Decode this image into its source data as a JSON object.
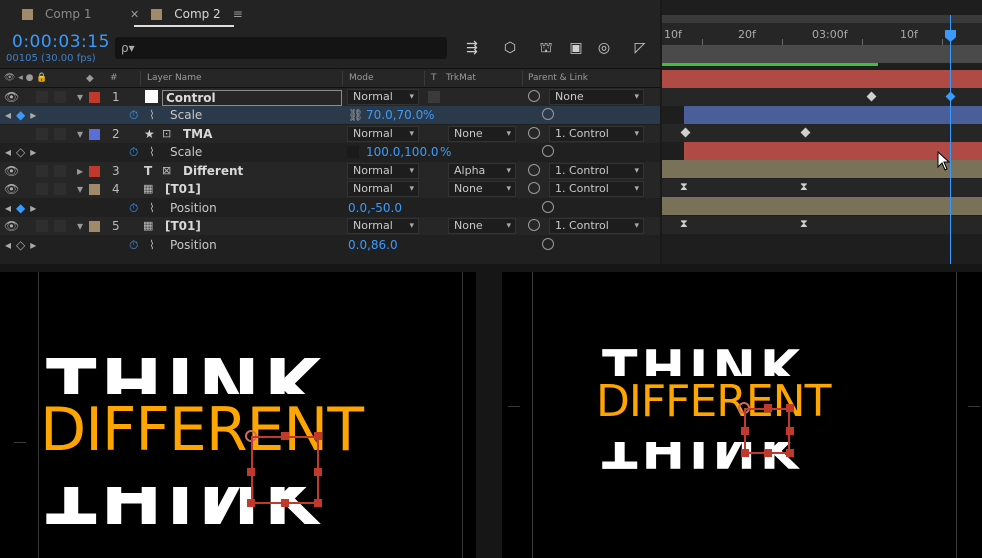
{
  "tabs": [
    {
      "label": "Comp 1",
      "color": "#a08a6a"
    },
    {
      "label": "Comp 2",
      "color": "#a08a6a",
      "active": true
    }
  ],
  "timecode": "0:00:03:15",
  "fps_info": "00105 (30.00 fps)",
  "search": {
    "placeholder": "ρ▾"
  },
  "columns": {
    "layer_name": "Layer Name",
    "mode": "Mode",
    "t": "T",
    "trkmat": "TrkMat",
    "parent": "Parent & Link",
    "hash": "#"
  },
  "layers": [
    {
      "num": "1",
      "name": "Control",
      "color": "#c0392b",
      "type_icon": "solid",
      "mode": "Normal",
      "trkmat": "",
      "parent": "None",
      "prop": {
        "name": "Scale",
        "value": "70.0,70.0",
        "unit": "%",
        "linked": true
      }
    },
    {
      "num": "2",
      "name": "TMA",
      "color": "#5a6fd6",
      "type_icon": "star",
      "mode": "Normal",
      "trkmat": "None",
      "parent": "1. Control",
      "prop": {
        "name": "Scale",
        "value": "100.0,100.0",
        "unit": "%"
      }
    },
    {
      "num": "3",
      "name": "Different",
      "color": "#c0392b",
      "type_icon": "text",
      "mode": "Normal",
      "trkmat": "Alpha",
      "parent": "1. Control"
    },
    {
      "num": "4",
      "name": "[T01]",
      "color": "#a08a6a",
      "type_icon": "precomp",
      "mode": "Normal",
      "trkmat": "None",
      "parent": "1. Control",
      "prop": {
        "name": "Position",
        "value": "0.0,-50.0"
      }
    },
    {
      "num": "5",
      "name": "[T01]",
      "color": "#a08a6a",
      "type_icon": "precomp",
      "mode": "Normal",
      "trkmat": "None",
      "parent": "1. Control",
      "prop": {
        "name": "Position",
        "value": "0.0,86.0"
      }
    }
  ],
  "ruler": {
    "labels": [
      "10f",
      "20f",
      "03:00f",
      "10f"
    ]
  },
  "timeline_colors": {
    "layer1": "#b04a45",
    "layer2": "#4a5f9a",
    "layer3": "#b04a45",
    "layer4": "#7a7258",
    "layer5": "#7a7258"
  },
  "viewer": {
    "think": "THINK",
    "different": "DIFFERENT",
    "text_color": "#ffffff",
    "accent_color": "#ffa500"
  }
}
